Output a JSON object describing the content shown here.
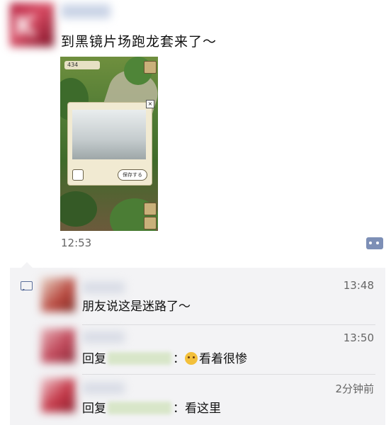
{
  "post": {
    "text": "到黑镜片场跑龙套来了～",
    "time": "12:53",
    "image": {
      "topbar_value": "434",
      "save_label": "保存する"
    }
  },
  "comments": [
    {
      "time": "13:48",
      "text": "朋友说这是迷路了～"
    },
    {
      "time": "13:50",
      "reply_label": "回复",
      "separator": "：",
      "text": "看着很惨",
      "emoji": "grimacing-face-emoji"
    },
    {
      "time": "2分钟前",
      "reply_label": "回复",
      "separator": "：",
      "text": "看这里"
    }
  ],
  "colors": {
    "link": "#5b6f9b",
    "comment_bg": "#f3f3f5"
  }
}
